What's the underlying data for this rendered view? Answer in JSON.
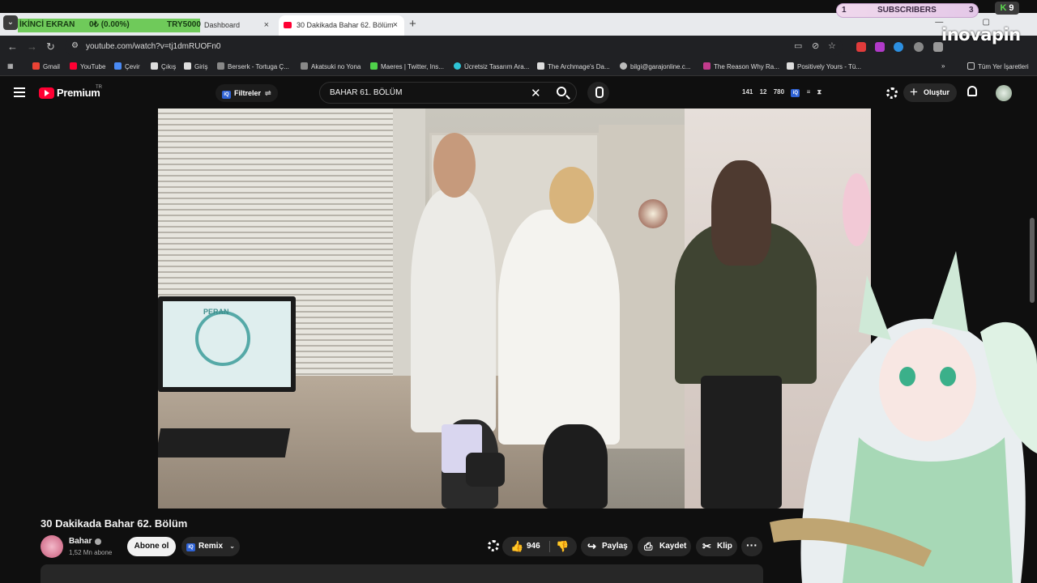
{
  "overlay": {
    "screen_label": "İKİNCİ EKRAN",
    "goal_progress": "0₺ (0.00%)",
    "goal_target": "TRY5000",
    "subscribers_count_left": "1",
    "subscribers_label": "SUBSCRIBERS",
    "subscribers_count_right": "3",
    "kick_letter": "K",
    "kick_count": "9",
    "brand": "inovapin"
  },
  "browser": {
    "tabs": [
      {
        "title": "Dashboard",
        "close": "×"
      },
      {
        "title": "30 Dakikada Bahar 62. Bölüm",
        "close": "×"
      }
    ],
    "new_tab": "+",
    "url": "youtube.com/watch?v=tj1dmRUOFn0",
    "bookmarks": [
      "Gmail",
      "YouTube",
      "Çevir",
      "Çıkış",
      "Giriş",
      "Berserk - Tortuga Ç...",
      "Akatsuki no Yona",
      "Maeres | Twitter, Ins...",
      "Ücretsiz Tasarım Ara...",
      "The Archmage's Da...",
      "bilgi@garajonline.c...",
      "The Reason Why Ra...",
      "Positively Yours - Tü..."
    ],
    "bookmarks_more": "»",
    "all_bookmarks": "Tüm Yer İşaretleri"
  },
  "youtube": {
    "logo_text": "Premium",
    "region": "TR",
    "filters_label": "Filtreler",
    "search_value": "BAHAR 61. BÖLÜM",
    "stat_likes": "141",
    "stat_views_a": "12",
    "stat_views_b": "780",
    "create_label": "Oluştur",
    "video": {
      "title": "30 Dakikada Bahar 62. Bölüm",
      "monitor_text": "PERAN",
      "channel": "Bahar",
      "subscribers": "1,52 Mn abone",
      "subscribe_label": "Abone ol",
      "remix_label": "Remix",
      "like_count": "946",
      "share_label": "Paylaş",
      "save_label": "Kaydet",
      "clip_label": "Klip",
      "more_label": "···"
    }
  },
  "colors": {
    "youtube_red": "#ff0033",
    "overlay_green": "#6fca5a",
    "page_bg": "#0f0f0f"
  }
}
